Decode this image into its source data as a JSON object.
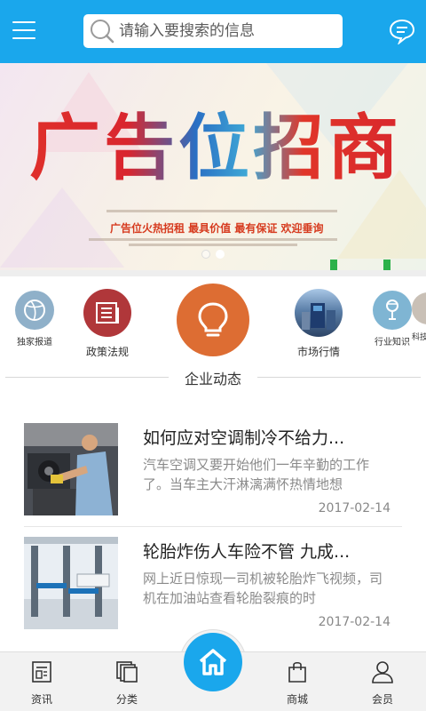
{
  "header": {
    "search_placeholder": "请输入要搜索的信息",
    "accent_color": "#1aa7ec",
    "icons": {
      "menu": "menu-icon",
      "search": "search-icon",
      "chat": "chat-icon"
    }
  },
  "banner": {
    "title": "广告位招商",
    "subtitle": "广告位火热招租  最具价值  最有保证  欢迎垂询",
    "slide_count": 2,
    "active_slide": 2
  },
  "categories": [
    {
      "label": "独家报道",
      "icon": "basketball-icon"
    },
    {
      "label": "政策法规",
      "icon": "document-icon"
    },
    {
      "label": "企业动态",
      "icon": "lightbulb-icon"
    },
    {
      "label": "市场行情",
      "icon": "market-photo"
    },
    {
      "label": "行业知识",
      "icon": "microphone-icon"
    },
    {
      "label": "科技"
    }
  ],
  "news": [
    {
      "title": "如何应对空调制冷不给力...",
      "summary": "汽车空调又要开始他们一年辛勤的工作了。当车主大汗淋漓满怀热情地想",
      "date": "2017-02-14"
    },
    {
      "title": "轮胎炸伤人车险不管 九成...",
      "summary": "网上近日惊现一司机被轮胎炸飞视频，司机在加油站查看轮胎裂痕的时",
      "date": "2017-02-14"
    }
  ],
  "bottom_nav": [
    {
      "label": "资讯",
      "icon": "news-icon"
    },
    {
      "label": "分类",
      "icon": "category-icon"
    },
    {
      "label": "",
      "icon": "home-icon"
    },
    {
      "label": "商城",
      "icon": "shopping-bag-icon"
    },
    {
      "label": "会员",
      "icon": "user-icon"
    }
  ]
}
